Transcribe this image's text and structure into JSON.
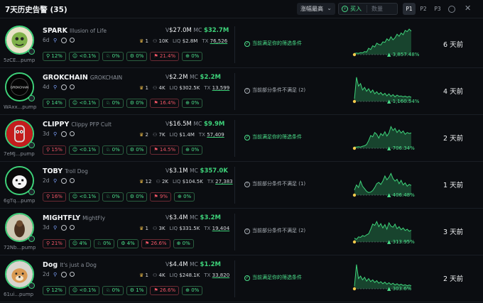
{
  "header": {
    "title": "7天历史告警 (35)",
    "sort_label": "涨幅最高",
    "buy_label": "买入",
    "qty_placeholder": "数量",
    "presets": [
      "P1",
      "P2",
      "P3"
    ]
  },
  "colors": {
    "green": "#3ed37a",
    "red": "#f05565",
    "bg": "#0b0d11"
  },
  "rows": [
    {
      "symbol": "SPARK",
      "full_name": "Illusion of Life",
      "age": "6d",
      "address": "5zCE...pump",
      "volume": "$27.0M",
      "mc": "$32.7M",
      "holders_top": "1",
      "holders": "10K",
      "liq": "$2.8M",
      "tx": "76,526",
      "chips": [
        [
          "12%",
          "g"
        ],
        [
          "<0.1%",
          "g"
        ],
        [
          "0%",
          "g"
        ],
        [
          "0%",
          "g"
        ],
        [
          "21.4%",
          "r"
        ],
        [
          "0%",
          "g"
        ]
      ],
      "condition": "当前满足你的筛选条件",
      "condition_state": "ok",
      "change": "3,857.48%",
      "ago": "6 天前",
      "chart_series": [
        0.05,
        0.06,
        0.05,
        0.08,
        0.07,
        0.12,
        0.1,
        0.25,
        0.2,
        0.35,
        0.3,
        0.45,
        0.4,
        0.38,
        0.5,
        0.48,
        0.62,
        0.55,
        0.7,
        0.58,
        0.66,
        0.8,
        0.72,
        0.85,
        0.78,
        0.95,
        0.9,
        1.0,
        0.92
      ],
      "avatar": "spark"
    },
    {
      "symbol": "GROKCHAIN",
      "full_name": "GROKCHAIN",
      "age": "4d",
      "address": "WAxx...pump",
      "volume": "$2.2M",
      "mc": "$2.2M",
      "holders_top": "1",
      "holders": "4K",
      "liq": "$302.5K",
      "tx": "13,599",
      "chips": [
        [
          "14%",
          "g"
        ],
        [
          "<0.1%",
          "g"
        ],
        [
          "0%",
          "g"
        ],
        [
          "0%",
          "g"
        ],
        [
          "16.4%",
          "r"
        ],
        [
          "0%",
          "g"
        ]
      ],
      "condition": "当前部分条件不满足 (2)",
      "condition_state": "partial",
      "change": "1,160.54%",
      "ago": "4 天前",
      "chart_series": [
        0.1,
        0.95,
        0.6,
        0.7,
        0.45,
        0.55,
        0.4,
        0.5,
        0.35,
        0.45,
        0.3,
        0.38,
        0.28,
        0.35,
        0.25,
        0.32,
        0.22,
        0.3,
        0.2,
        0.27,
        0.18,
        0.25,
        0.2,
        0.22,
        0.18,
        0.21,
        0.17,
        0.2,
        0.16
      ],
      "avatar": "grok"
    },
    {
      "symbol": "CLIPPY",
      "full_name": "Clippy PFP Cult",
      "age": "3d",
      "address": "7eMJ...pump",
      "volume": "$16.5M",
      "mc": "$9.9M",
      "holders_top": "2",
      "holders": "7K",
      "liq": "$1.4M",
      "tx": "57,409",
      "chips": [
        [
          "15%",
          "r"
        ],
        [
          "<0.1%",
          "g"
        ],
        [
          "0%",
          "g"
        ],
        [
          "0%",
          "g"
        ],
        [
          "14.5%",
          "r"
        ],
        [
          "0%",
          "g"
        ]
      ],
      "condition": "当前满足你的筛选条件",
      "condition_state": "ok",
      "change": "706.34%",
      "ago": "2 天前",
      "chart_series": [
        0.05,
        0.05,
        0.06,
        0.05,
        0.08,
        0.1,
        0.15,
        0.3,
        0.5,
        0.45,
        0.62,
        0.55,
        0.4,
        0.58,
        0.5,
        0.65,
        0.48,
        0.6,
        0.85,
        0.7,
        0.78,
        0.62,
        0.72,
        0.6,
        0.68,
        0.55,
        0.62,
        0.58,
        0.6
      ],
      "avatar": "clippy"
    },
    {
      "symbol": "TOBY",
      "full_name": "Troll Dog",
      "age": "2d",
      "address": "6gTq...pump",
      "volume": "$3.1M",
      "mc": "$357.0K",
      "holders_top": "12",
      "holders": "2K",
      "liq": "$104.5K",
      "tx": "27,383",
      "chips": [
        [
          "16%",
          "r"
        ],
        [
          "<0.1%",
          "g"
        ],
        [
          "0%",
          "g"
        ],
        [
          "0%",
          "g"
        ],
        [
          "9%",
          "r"
        ],
        [
          "0%",
          "g"
        ]
      ],
      "condition": "当前部分条件不满足 (1)",
      "condition_state": "partial",
      "change": "406.48%",
      "ago": "1 天前",
      "chart_series": [
        0.2,
        0.4,
        0.3,
        0.55,
        0.35,
        0.25,
        0.15,
        0.1,
        0.12,
        0.18,
        0.3,
        0.45,
        0.5,
        0.42,
        0.55,
        0.75,
        0.6,
        0.7,
        0.85,
        0.65,
        0.55,
        0.62,
        0.45,
        0.58,
        0.4,
        0.48,
        0.35,
        0.42,
        0.38
      ],
      "avatar": "toby"
    },
    {
      "symbol": "MIGHTFLY",
      "full_name": "MightFly",
      "age": "3d",
      "address": "72Nb...pump",
      "volume": "$3.4M",
      "mc": "$3.2M",
      "holders_top": "1",
      "holders": "3K",
      "liq": "$331.5K",
      "tx": "19,404",
      "chips": [
        [
          "21%",
          "r"
        ],
        [
          "4%",
          "g"
        ],
        [
          "0%",
          "g"
        ],
        [
          "4%",
          "g"
        ],
        [
          "26.6%",
          "r"
        ],
        [
          "0%",
          "g"
        ]
      ],
      "condition": "当前部分条件不满足 (2)",
      "condition_state": "partial",
      "change": "313.95%",
      "ago": "3 天前",
      "chart_series": [
        0.15,
        0.1,
        0.2,
        0.18,
        0.25,
        0.22,
        0.28,
        0.32,
        0.5,
        0.7,
        0.65,
        0.8,
        0.6,
        0.72,
        0.55,
        0.68,
        0.5,
        0.75,
        0.62,
        0.58,
        0.7,
        0.52,
        0.6,
        0.48,
        0.55,
        0.45,
        0.5,
        0.42,
        0.46
      ],
      "avatar": "fly"
    },
    {
      "symbol": "Dog",
      "full_name": "It's just a Dog",
      "age": "2d",
      "address": "61ui...pump",
      "volume": "$4.4M",
      "mc": "$1.2M",
      "holders_top": "1",
      "holders": "4K",
      "liq": "$248.1K",
      "tx": "33,820",
      "chips": [
        [
          "12%",
          "g"
        ],
        [
          "<0.1%",
          "g"
        ],
        [
          "0%",
          "g"
        ],
        [
          "1%",
          "g"
        ],
        [
          "26.6%",
          "r"
        ],
        [
          "0%",
          "g"
        ]
      ],
      "condition": "当前满足你的筛选条件",
      "condition_state": "ok",
      "change": "303.6%",
      "ago": "2 天前",
      "chart_series": [
        0.1,
        0.95,
        0.4,
        0.5,
        0.35,
        0.45,
        0.3,
        0.4,
        0.28,
        0.35,
        0.25,
        0.32,
        0.22,
        0.28,
        0.2,
        0.26,
        0.18,
        0.24,
        0.17,
        0.22,
        0.15,
        0.2,
        0.14,
        0.18,
        0.13,
        0.16,
        0.12,
        0.15,
        0.12
      ],
      "avatar": "dog"
    }
  ],
  "labels": {
    "vol": "V",
    "mc": "MC",
    "liq": "LIQ",
    "tx": "TX"
  }
}
